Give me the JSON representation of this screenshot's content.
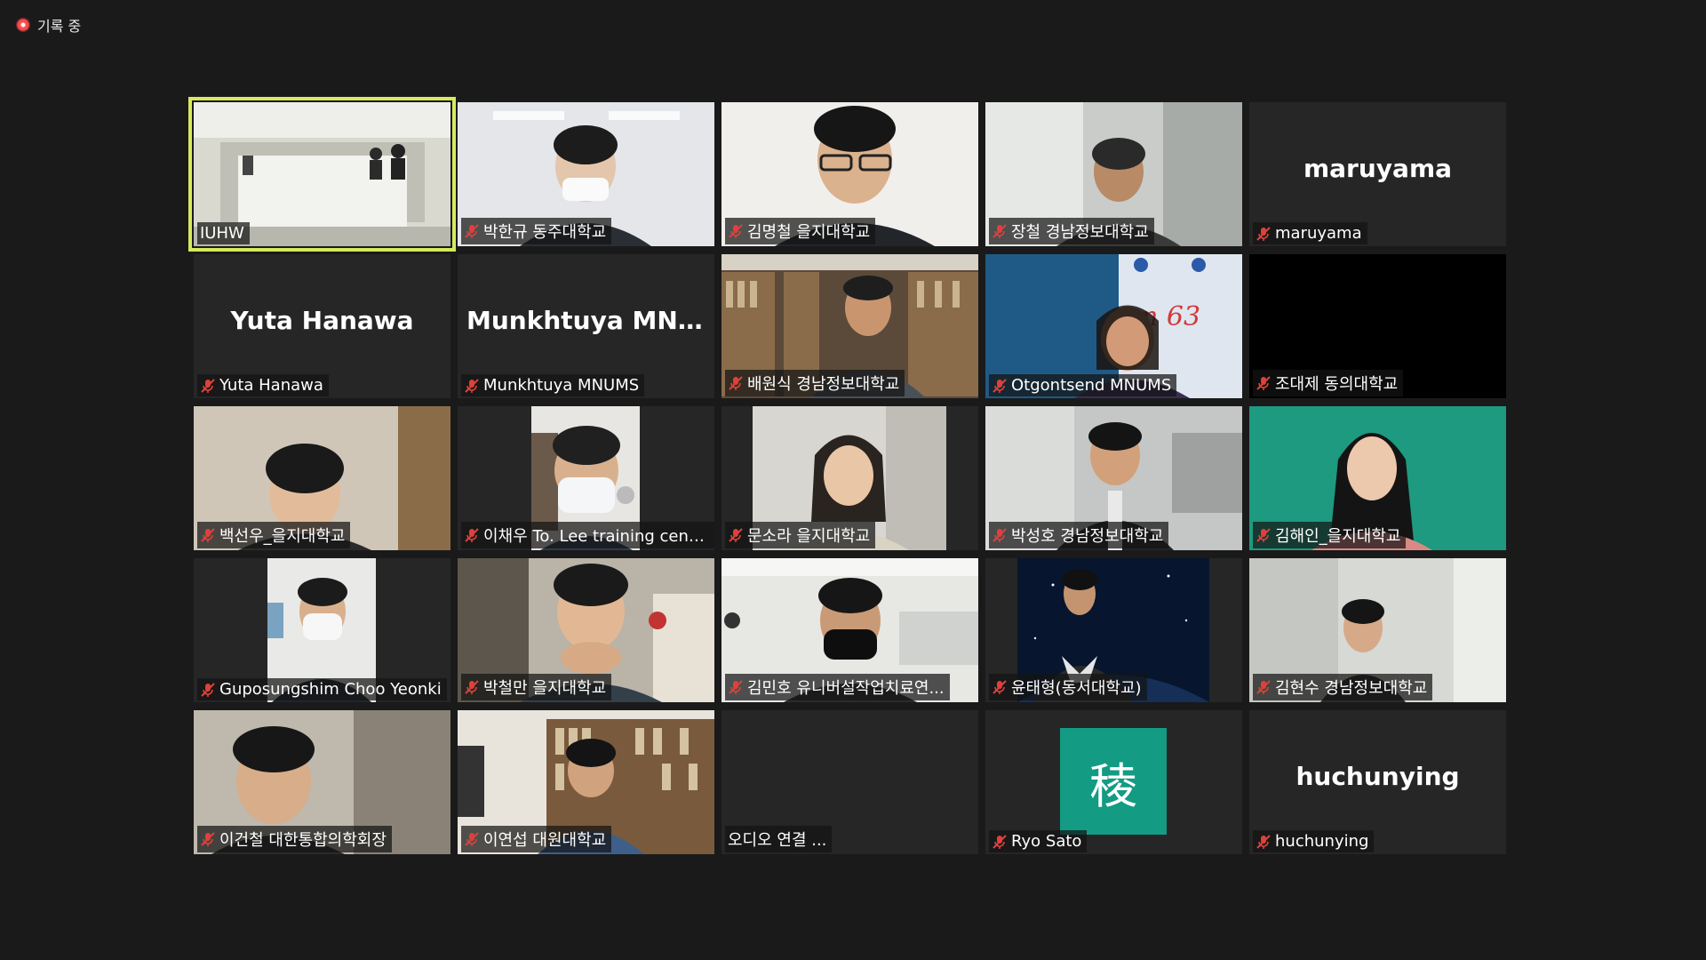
{
  "recording": {
    "label": "기록 중"
  },
  "tiles": [
    {
      "name": "IUHW",
      "muted": false,
      "type": "video",
      "active": true
    },
    {
      "name": "박한규 동주대학교",
      "muted": true,
      "type": "video"
    },
    {
      "name": "김명철 을지대학교",
      "muted": true,
      "type": "video"
    },
    {
      "name": "장철 경남정보대학교",
      "muted": true,
      "type": "video"
    },
    {
      "name": "maruyama",
      "muted": true,
      "type": "name",
      "center": "maruyama"
    },
    {
      "name": "Yuta Hanawa",
      "muted": true,
      "type": "name",
      "center": "Yuta Hanawa"
    },
    {
      "name": "Munkhtuya MNUMS",
      "muted": true,
      "type": "name",
      "center": "Munkhtuya  MN..."
    },
    {
      "name": "배원식 경남정보대학교",
      "muted": true,
      "type": "video"
    },
    {
      "name": "Otgontsend MNUMS",
      "muted": true,
      "type": "video"
    },
    {
      "name": "조대제 동의대학교",
      "muted": true,
      "type": "black"
    },
    {
      "name": "백선우_을지대학교",
      "muted": true,
      "type": "video"
    },
    {
      "name": "이채우 To. Lee training center",
      "muted": true,
      "type": "video"
    },
    {
      "name": "문소라 을지대학교",
      "muted": true,
      "type": "video"
    },
    {
      "name": "박성호 경남정보대학교",
      "muted": true,
      "type": "video"
    },
    {
      "name": "김해인_을지대학교",
      "muted": true,
      "type": "video"
    },
    {
      "name": "Guposungshim Choo Yeonki",
      "muted": true,
      "type": "video"
    },
    {
      "name": "박철만 을지대학교",
      "muted": true,
      "type": "video"
    },
    {
      "name": "김민호 유니버설작업치료연...",
      "muted": true,
      "type": "video"
    },
    {
      "name": "윤태형(동서대학교)",
      "muted": true,
      "type": "video"
    },
    {
      "name": "김현수 경남정보대학교",
      "muted": true,
      "type": "video"
    },
    {
      "name": "이건철 대한통합의학회장",
      "muted": true,
      "type": "video"
    },
    {
      "name": "이연섭 대원대학교",
      "muted": true,
      "type": "video"
    },
    {
      "name": "오디오 연결 ...",
      "muted": false,
      "type": "empty"
    },
    {
      "name": "Ryo Sato",
      "muted": true,
      "type": "avatar",
      "avatar_text": "稜",
      "avatar_color": "#139b84"
    },
    {
      "name": "huchunying",
      "muted": true,
      "type": "name",
      "center": "huchunying"
    }
  ],
  "colors": {
    "background": "#1a1a1a",
    "tile": "#262626",
    "active_border": "#d7ea5a",
    "mute": "#e0403a"
  }
}
